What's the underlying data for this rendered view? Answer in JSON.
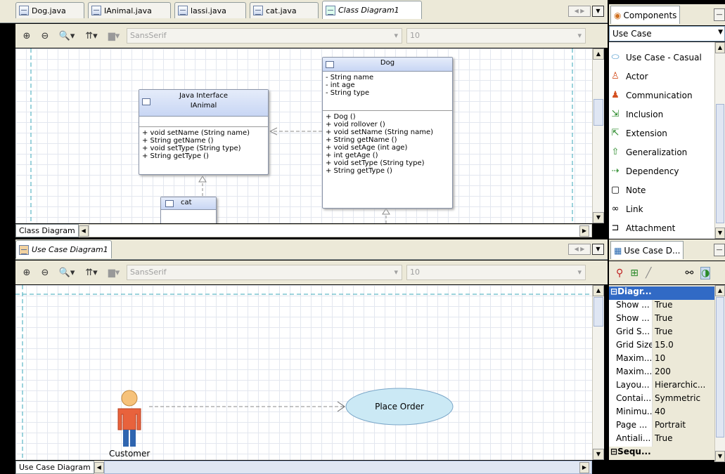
{
  "top_tabs": [
    {
      "label": "Dog.java"
    },
    {
      "label": "IAnimal.java"
    },
    {
      "label": "lassi.java"
    },
    {
      "label": "cat.java"
    },
    {
      "label": "Class Diagram1"
    }
  ],
  "toolbar": {
    "font_family": "SansSerif",
    "font_size": "10",
    "zoom_in": "⊕",
    "zoom_out": "⊖",
    "zoom_fit": "🔍▾",
    "align": "⇈▾",
    "color": "▆▾"
  },
  "class_diagram": {
    "dog": {
      "title": "Dog",
      "attrs": [
        "- String name",
        "- int age",
        "- String type"
      ],
      "methods": [
        "+ Dog ()",
        "+ void rollover ()",
        "+ void setName (String name)",
        "+ String getName ()",
        "+ void setAge (int age)",
        "+ int getAge ()",
        "+ void setType (String type)",
        "+ String getType ()"
      ]
    },
    "ianimal": {
      "stereotype": "Java Interface",
      "title": "IAnimal",
      "methods": [
        "+ void setName (String name)",
        "+ String getName ()",
        "+ void setType (String type)",
        "+ String getType ()"
      ]
    },
    "cat": {
      "title": "cat"
    },
    "bottom_label": "Class Diagram"
  },
  "use_case_tab": "Use Case Diagram1",
  "use_case": {
    "actor": "Customer",
    "usecase": "Place Order",
    "bottom_label": "Use Case Diagram"
  },
  "components": {
    "tab": "Components",
    "selected": "Use Case",
    "items": [
      {
        "label": "Use Case - Casual",
        "icon": "use-case-icon"
      },
      {
        "label": "Actor",
        "icon": "actor-icon"
      },
      {
        "label": "Communication",
        "icon": "communication-icon"
      },
      {
        "label": "Inclusion",
        "icon": "inclusion-icon"
      },
      {
        "label": "Extension",
        "icon": "extension-icon"
      },
      {
        "label": "Generalization",
        "icon": "generalization-icon"
      },
      {
        "label": "Dependency",
        "icon": "dependency-icon"
      },
      {
        "label": "Note",
        "icon": "note-icon"
      },
      {
        "label": "Link",
        "icon": "link-icon"
      },
      {
        "label": "Attachment",
        "icon": "attachment-icon"
      }
    ]
  },
  "properties": {
    "tab": "Use Case D...",
    "section": "Diagr...",
    "section2": "Sequ...",
    "rows": [
      {
        "k": "Show ...",
        "v": "True"
      },
      {
        "k": "Show ...",
        "v": "True"
      },
      {
        "k": "Grid S...",
        "v": "True"
      },
      {
        "k": "Grid Size",
        "v": "15.0"
      },
      {
        "k": "Maxim...",
        "v": "10"
      },
      {
        "k": "Maxim...",
        "v": "200"
      },
      {
        "k": "Layou...",
        "v": "Hierarchic..."
      },
      {
        "k": "Contai...",
        "v": "Symmetric"
      },
      {
        "k": "Minimu...",
        "v": "40"
      },
      {
        "k": "Page ...",
        "v": "Portrait"
      },
      {
        "k": "Antiali...",
        "v": "True"
      }
    ]
  }
}
